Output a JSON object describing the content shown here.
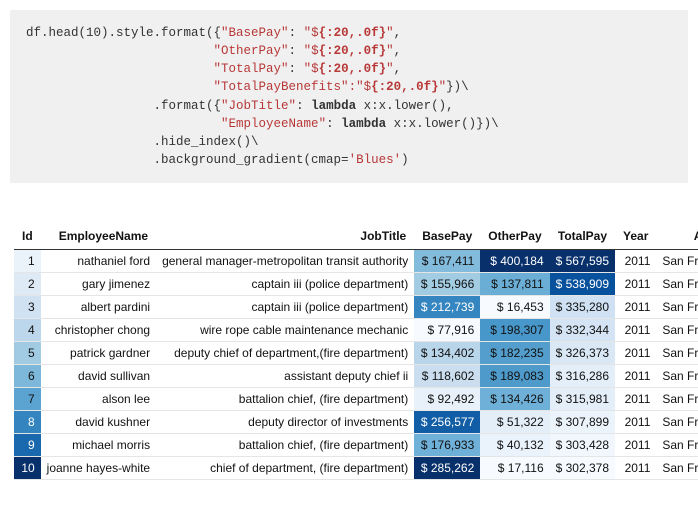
{
  "code": {
    "line1_a": "df.head(10).style.format({",
    "line1_b": "\"BasePay\"",
    "line1_c": ": ",
    "line1_d": "\"$",
    "line1_e": "{:20,.0f}",
    "line1_f": "\"",
    "line1_g": ",",
    "indent2": "                         ",
    "otherpay_key": "\"OtherPay\"",
    "otherpay_val_a": "\"$",
    "otherpay_val_b": "{:20,.0f}",
    "otherpay_val_c": "\"",
    "totalpay_key": "\"TotalPay\"",
    "totalpay_val_a": "\"$",
    "totalpay_val_b": "{:20,.0f}",
    "totalpay_val_c": "\"",
    "tpb_key": "\"TotalPayBenefits\"",
    "tpb_val_a": ":\"$",
    "tpb_val_b": "{:20,.0f}",
    "tpb_val_c": "\"",
    "close1": "})\\",
    "indent3": "                 ",
    "fmt2_a": ".format({",
    "jobtitle_key": "\"JobTitle\"",
    "lambda": "lambda",
    "lambda_body": " x:x.lower(),",
    "indent4": "                          ",
    "empname_key": "\"EmployeeName\"",
    "lambda_body2": " x:x.lower()})\\",
    "hide": ".hide_index()\\",
    "bg_a": ".background_gradient(cmap=",
    "bg_b": "'Blues'",
    "bg_c": ")",
    "colon": ": "
  },
  "headers": [
    "Id",
    "EmployeeName",
    "JobTitle",
    "BasePay",
    "OtherPay",
    "TotalPay",
    "Year",
    "Agency"
  ],
  "rows": [
    {
      "id": "1",
      "employee": "nathaniel ford",
      "job": "general manager-metropolitan transit authority",
      "base": "$ 167,411",
      "other": "$ 400,184",
      "total": "$ 567,595",
      "year": "2011",
      "agency": "San Francisco",
      "c_id": "#ebf3fa",
      "c_base": "#83bbdc",
      "c_other": "#08306b",
      "c_total": "#08306b"
    },
    {
      "id": "2",
      "employee": "gary jimenez",
      "job": "captain iii (police department)",
      "base": "$ 155,966",
      "other": "$ 137,811",
      "total": "$ 538,909",
      "year": "2011",
      "agency": "San Francisco",
      "c_id": "#deebf7",
      "c_base": "#a2cce2",
      "c_other": "#6aaed6",
      "c_total": "#08519c"
    },
    {
      "id": "3",
      "employee": "albert pardini",
      "job": "captain iii (police department)",
      "base": "$ 212,739",
      "other": "$ 16,453",
      "total": "$ 335,280",
      "year": "2011",
      "agency": "San Francisco",
      "c_id": "#d0e1f2",
      "c_base": "#3585c0",
      "c_other": "#f7fbff",
      "c_total": "#cfe1f2"
    },
    {
      "id": "4",
      "employee": "christopher chong",
      "job": "wire rope cable maintenance mechanic",
      "base": "$ 77,916",
      "other": "$ 198,307",
      "total": "$ 332,344",
      "year": "2011",
      "agency": "San Francisco",
      "c_id": "#bcd7eb",
      "c_base": "#f7fbff",
      "c_other": "#4897ca",
      "c_total": "#d4e4f4"
    },
    {
      "id": "5",
      "employee": "patrick gardner",
      "job": "deputy chief of department,(fire department)",
      "base": "$ 134,402",
      "other": "$ 182,235",
      "total": "$ 326,373",
      "year": "2011",
      "agency": "San Francisco",
      "c_id": "#a1cbe2",
      "c_base": "#b8d5ea",
      "c_other": "#549ecd",
      "c_total": "#dae8f5"
    },
    {
      "id": "6",
      "employee": "david sullivan",
      "job": "assistant deputy chief ii",
      "base": "$ 118,602",
      "other": "$ 189,083",
      "total": "$ 316,286",
      "year": "2011",
      "agency": "San Francisco",
      "c_id": "#7db8da",
      "c_base": "#cadef0",
      "c_other": "#4e9acb",
      "c_total": "#e3eef8"
    },
    {
      "id": "7",
      "employee": "alson lee",
      "job": "battalion chief, (fire department)",
      "base": "$ 92,492",
      "other": "$ 134,426",
      "total": "$ 315,981",
      "year": "2011",
      "agency": "San Francisco",
      "c_id": "#5ba3d0",
      "c_base": "#e8f1fa",
      "c_other": "#6fb0d8",
      "c_total": "#e4eef9"
    },
    {
      "id": "8",
      "employee": "david kushner",
      "job": "deputy director of investments",
      "base": "$ 256,577",
      "other": "$ 51,322",
      "total": "$ 307,899",
      "year": "2011",
      "agency": "San Francisco",
      "c_id": "#3484bf",
      "c_base": "#125ea6",
      "c_other": "#e3eef8",
      "c_total": "#ecf4fb"
    },
    {
      "id": "9",
      "employee": "michael morris",
      "job": "battalion chief, (fire department)",
      "base": "$ 176,933",
      "other": "$ 40,132",
      "total": "$ 303,428",
      "year": "2011",
      "agency": "San Francisco",
      "c_id": "#1a68ad",
      "c_base": "#6fb0d8",
      "c_other": "#eaf2fb",
      "c_total": "#f1f7fd"
    },
    {
      "id": "10",
      "employee": "joanne hayes-white",
      "job": "chief of department, (fire department)",
      "base": "$ 285,262",
      "other": "$ 17,116",
      "total": "$ 302,378",
      "year": "2011",
      "agency": "San Francisco",
      "c_id": "#08306b",
      "c_base": "#08306b",
      "c_other": "#f7fbff",
      "c_total": "#f7fbff"
    }
  ]
}
